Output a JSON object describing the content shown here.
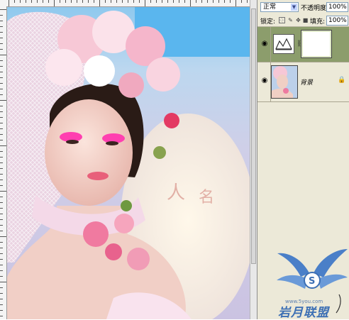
{
  "layers_panel": {
    "blend_mode": "正常",
    "opacity_label": "不透明度:",
    "opacity_value": "100%",
    "lock_label": "锁定:",
    "fill_label": "填充:",
    "fill_value": "100%",
    "layers": [
      {
        "name": "",
        "type": "adjustment",
        "visible": true,
        "selected": true
      },
      {
        "name": "背景",
        "type": "background",
        "visible": true,
        "locked": true
      }
    ]
  },
  "watermark": {
    "text": "岩月联盟",
    "url": "www.5you.com"
  },
  "colors": {
    "panel_bg": "#ece9d8",
    "selected_layer": "#8c9d6c",
    "canvas_bg": "#c9c9c9",
    "watermark_blue": "#3c6fb4"
  },
  "icons": [
    "eye-icon",
    "lock-icon",
    "brush-icon",
    "move-icon",
    "chain-icon",
    "levels-icon"
  ]
}
